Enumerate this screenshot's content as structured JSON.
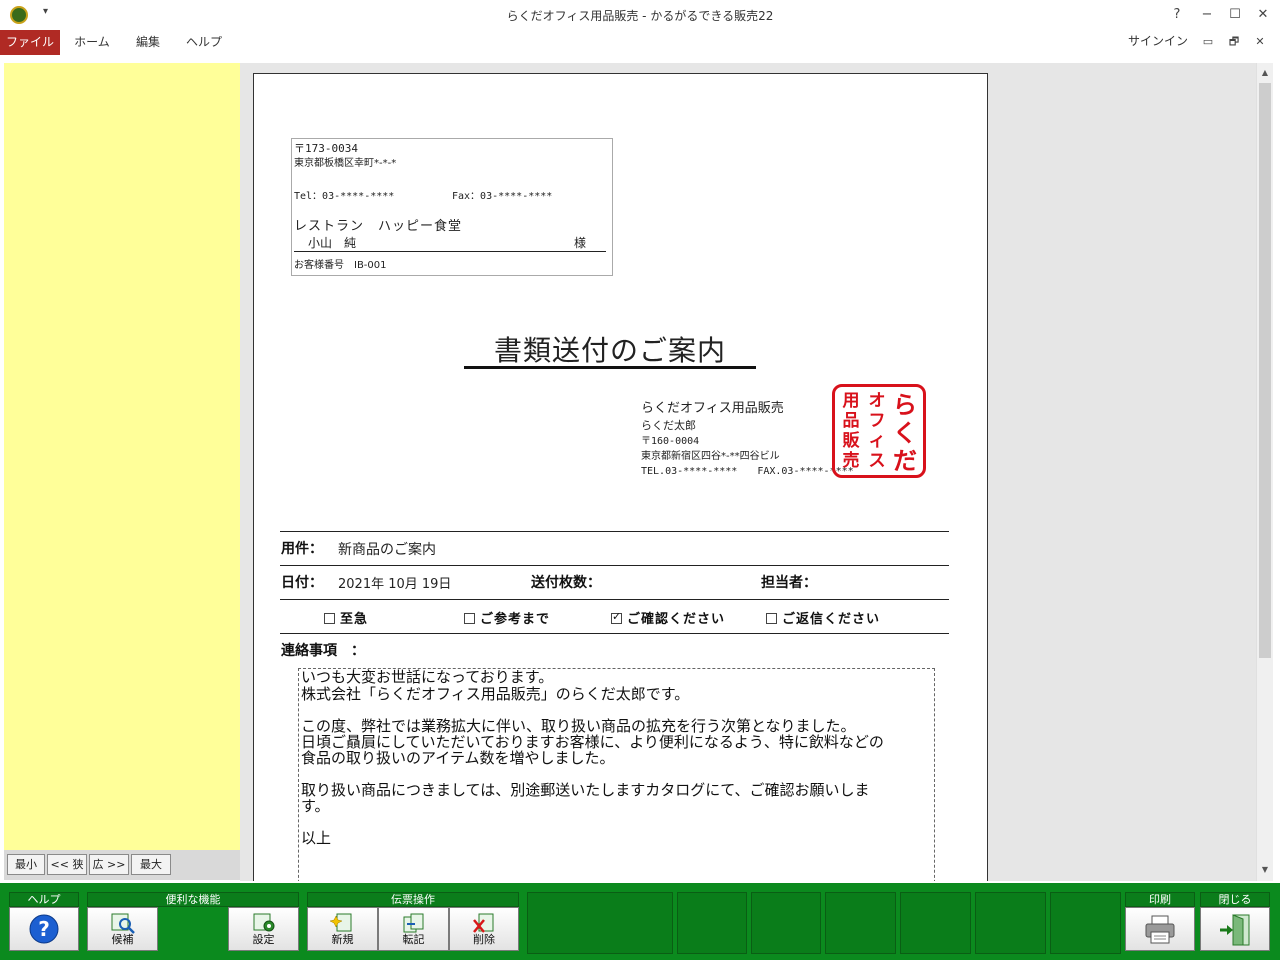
{
  "window": {
    "title": "らくだオフィス用品販売 - かるがるできる販売22",
    "help": "?",
    "minimize": "−",
    "maximize": "☐",
    "close": "✕"
  },
  "menu": {
    "items": [
      "ファイル",
      "ホーム",
      "編集",
      "ヘルプ"
    ],
    "signin": "サインイン",
    "restore": "🗗",
    "close": "✕"
  },
  "zoom": {
    "min": "最小",
    "narrow": "<< 狭",
    "wide": "広 >>",
    "max": "最大"
  },
  "document": {
    "recipient": {
      "zip": "〒173-0034",
      "address": "東京都板橋区幸町*-*-*",
      "tel": "Tel：03-****-****",
      "fax": "Fax：03-****-****",
      "company": "レストラン　ハッピー食堂",
      "person": "小山　純",
      "honorific": "様",
      "customer_no": "お客様番号　IB-001"
    },
    "title": "書類送付のご案内",
    "sender": {
      "company": "らくだオフィス用品販売",
      "person": "らくだ太郎",
      "zip": "〒160-0004",
      "address": "東京都新宿区四谷*-**四谷ビル",
      "telfax": "TEL.03-****-****　　FAX.03-****-****"
    },
    "stamp": {
      "col1": "用品販売",
      "col2": "オフィス",
      "col3": "らくだ"
    },
    "subject_label": "用件：",
    "subject_value": "新商品のご案内",
    "date_label": "日付：",
    "date_value": "2021年 10月 19日",
    "pages_label": "送付枚数：",
    "staff_label": "担当者：",
    "checks": [
      {
        "label": "至急",
        "checked": false
      },
      {
        "label": "ご参考まで",
        "checked": false
      },
      {
        "label": "ご確認ください",
        "checked": true
      },
      {
        "label": "ご返信ください",
        "checked": false
      }
    ],
    "notes_label": "連絡事項　：",
    "message": [
      "いつも大変お世話になっております。",
      "株式会社「らくだオフィス用品販売」のらくだ太郎です。",
      "",
      "この度、弊社では業務拡大に伴い、取り扱い商品の拡充を行う次第となりました。",
      "日頃ご贔屓にしていただいておりますお客様に、より便利になるよう、特に飲料などの",
      "食品の取り扱いのアイテム数を増やしました。",
      "",
      "取り扱い商品につきましては、別途郵送いたしますカタログにて、ご確認お願いしま",
      "す。",
      "",
      "以上"
    ]
  },
  "toolbar": {
    "help_group": "ヘルプ",
    "convenient_group": "便利な機能",
    "slip_group": "伝票操作",
    "print_group": "印刷",
    "close_group": "閉じる",
    "candidate": "候補",
    "settings": "設定",
    "new": "新規",
    "transfer": "転記",
    "delete": "削除"
  },
  "colors": {
    "menu_file_bg": "#b02a24",
    "left_panel": "#ffff99",
    "toolbar_green": "#0b8a1e",
    "stamp_red": "#d8111b"
  }
}
